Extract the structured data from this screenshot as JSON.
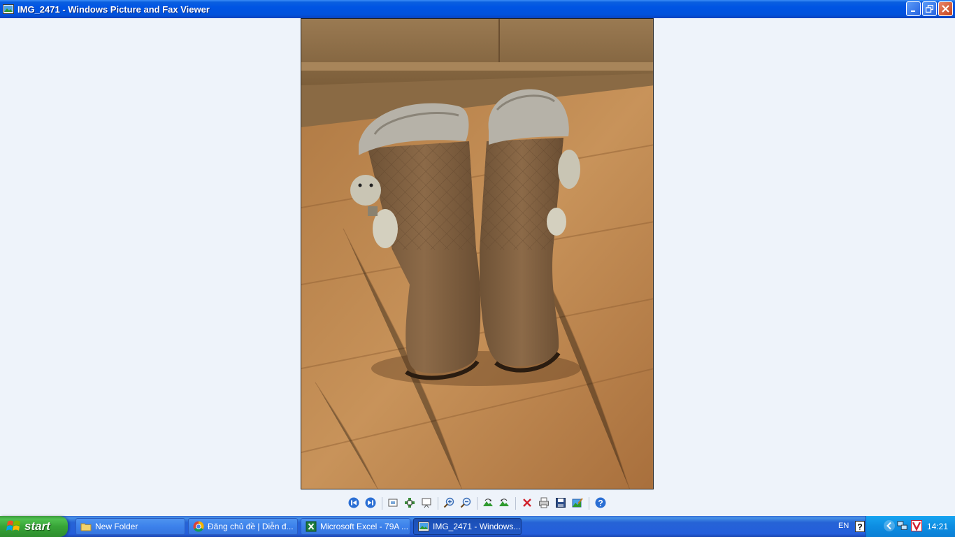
{
  "window": {
    "title": "IMG_2471 - Windows Picture and Fax Viewer",
    "icon": "picture-viewer-icon",
    "buttons": [
      "minimize-icon",
      "restore-icon",
      "close-icon"
    ]
  },
  "viewer": {
    "image_subject": "pair of brown quilted fur-trimmed boots on wooden floor",
    "toolbar": [
      {
        "name": "previous-image-button",
        "icon": "previous-icon"
      },
      {
        "name": "next-image-button",
        "icon": "next-icon"
      },
      {
        "name": "best-fit-button",
        "icon": "best-fit-icon"
      },
      {
        "name": "actual-size-button",
        "icon": "actual-size-icon"
      },
      {
        "name": "slideshow-button",
        "icon": "slideshow-icon"
      },
      {
        "name": "zoom-in-button",
        "icon": "zoom-in-icon"
      },
      {
        "name": "zoom-out-button",
        "icon": "zoom-out-icon"
      },
      {
        "name": "rotate-clockwise-button",
        "icon": "rotate-clockwise-icon"
      },
      {
        "name": "rotate-counterclockwise-button",
        "icon": "rotate-counterclockwise-icon"
      },
      {
        "name": "delete-button",
        "icon": "delete-icon"
      },
      {
        "name": "print-button",
        "icon": "print-icon"
      },
      {
        "name": "save-button",
        "icon": "save-icon"
      },
      {
        "name": "edit-button",
        "icon": "edit-icon"
      },
      {
        "name": "help-button",
        "icon": "help-icon"
      }
    ]
  },
  "taskbar": {
    "start_label": "start",
    "tasks": [
      {
        "label": "New Folder",
        "icon": "folder-icon",
        "active": false
      },
      {
        "label": "Đăng chủ đề | Diễn đ...",
        "icon": "chrome-icon",
        "active": false
      },
      {
        "label": "Microsoft Excel - 79A ...",
        "icon": "excel-icon",
        "active": false
      },
      {
        "label": "IMG_2471 - Windows...",
        "icon": "picture-viewer-icon",
        "active": true
      }
    ],
    "tray": {
      "language": "EN",
      "clock": "14:21",
      "icons": [
        "help-icon",
        "network-icon",
        "back-arrow-icon",
        "monitor-icon",
        "antivirus-icon"
      ]
    }
  },
  "colors": {
    "titlebar": "#0054e3",
    "client_bg": "#eef3fa",
    "taskbar": "#245edb",
    "start_green": "#37a437",
    "tray_blue": "#0d8de2"
  }
}
